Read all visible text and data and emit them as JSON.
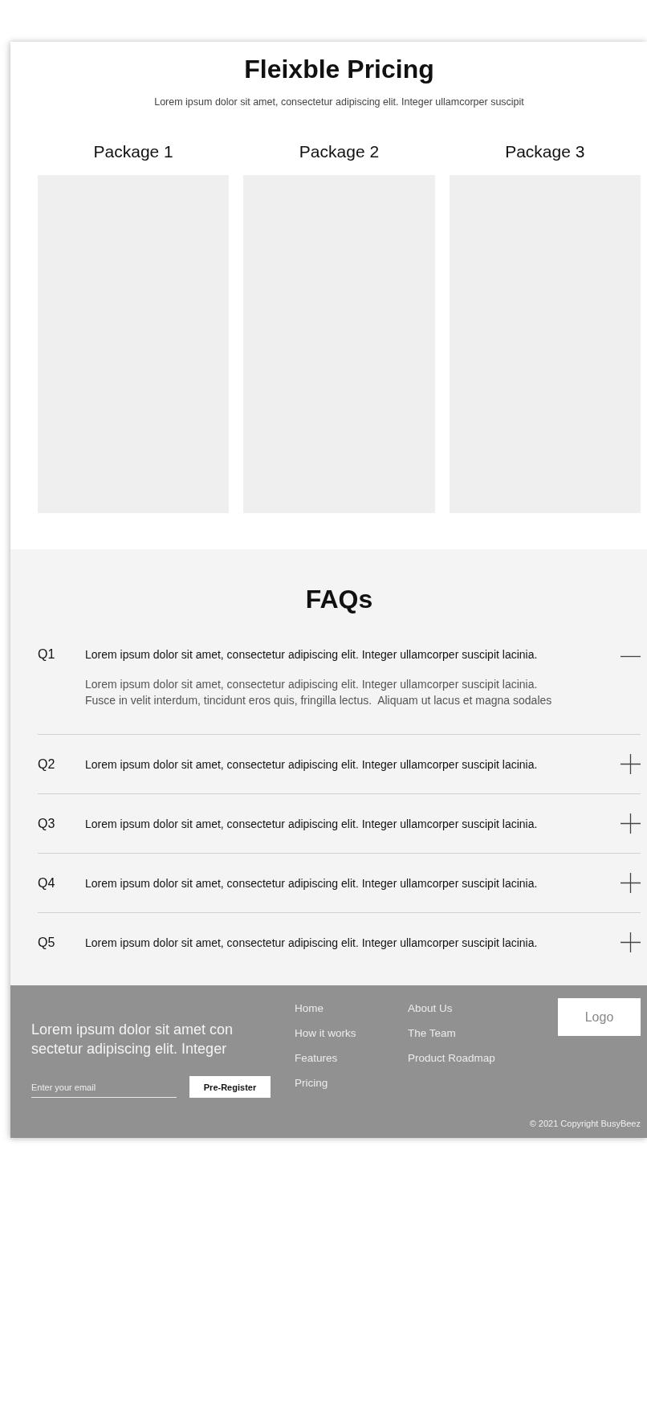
{
  "header": {
    "title": "Fleixble Pricing",
    "subtitle": "Lorem ipsum dolor sit amet, consectetur adipiscing elit. Integer ullamcorper suscipit"
  },
  "packages": [
    {
      "title": "Package 1"
    },
    {
      "title": "Package 2"
    },
    {
      "title": "Package 3"
    }
  ],
  "faq": {
    "title": "FAQs",
    "items": [
      {
        "label": "Q1",
        "question": "Lorem ipsum dolor sit amet, consectetur adipiscing elit. Integer ullamcorper suscipit lacinia.",
        "answer": "Lorem ipsum dolor sit amet, consectetur adipiscing elit. Integer ullamcorper suscipit lacinia.\nFusce in velit interdum, tincidunt eros quis, fringilla lectus.  Aliquam ut lacus et magna sodales",
        "expanded": true
      },
      {
        "label": "Q2",
        "question": "Lorem ipsum dolor sit amet, consectetur adipiscing elit. Integer ullamcorper suscipit lacinia.",
        "expanded": false
      },
      {
        "label": "Q3",
        "question": "Lorem ipsum dolor sit amet, consectetur adipiscing elit. Integer ullamcorper suscipit lacinia.",
        "expanded": false
      },
      {
        "label": "Q4",
        "question": "Lorem ipsum dolor sit amet, consectetur adipiscing elit. Integer ullamcorper suscipit lacinia.",
        "expanded": false
      },
      {
        "label": "Q5",
        "question": "Lorem ipsum dolor sit amet, consectetur adipiscing elit. Integer ullamcorper suscipit lacinia.",
        "expanded": false
      }
    ]
  },
  "footer": {
    "tagline": "Lorem ipsum dolor sit amet con sectetur adipiscing elit. Integer",
    "email": {
      "placeholder": "Enter your email"
    },
    "button": "Pre-Register",
    "links": [
      [
        "Home",
        "How it works",
        "Features",
        "Pricing"
      ],
      [
        "About Us",
        "The Team",
        "Product Roadmap"
      ]
    ],
    "logo": "Logo",
    "copyright": "© 2021 Copyright BusyBeez"
  }
}
